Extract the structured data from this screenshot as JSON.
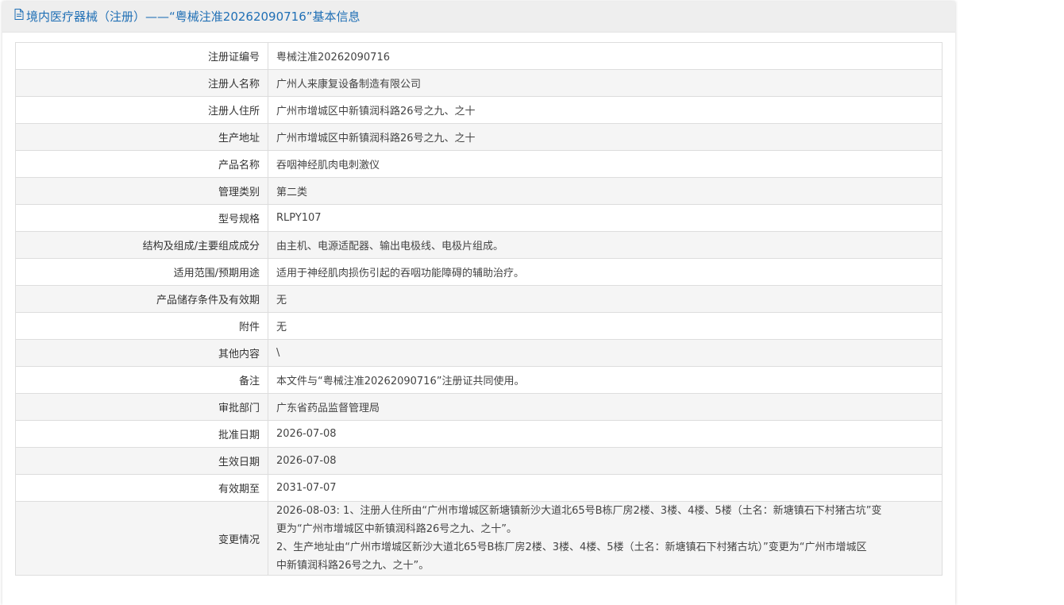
{
  "header": {
    "title": "境内医疗器械（注册）——“粤械注准20262090716”基本信息",
    "icon": "document-icon",
    "color": "#1f6fb5"
  },
  "rows": [
    {
      "label": "注册证编号",
      "value": "粤械注准20262090716"
    },
    {
      "label": "注册人名称",
      "value": "广州人来康复设备制造有限公司"
    },
    {
      "label": "注册人住所",
      "value": "广州市增城区中新镇润科路26号之九、之十"
    },
    {
      "label": "生产地址",
      "value": "广州市增城区中新镇润科路26号之九、之十"
    },
    {
      "label": "产品名称",
      "value": "吞咽神经肌肉电刺激仪"
    },
    {
      "label": "管理类别",
      "value": "第二类"
    },
    {
      "label": "型号规格",
      "value": "RLPY107"
    },
    {
      "label": "结构及组成/主要组成成分",
      "value": "由主机、电源适配器、输出电极线、电极片组成。"
    },
    {
      "label": "适用范围/预期用途",
      "value": "适用于神经肌肉损伤引起的吞咽功能障碍的辅助治疗。"
    },
    {
      "label": "产品储存条件及有效期",
      "value": "无"
    },
    {
      "label": "附件",
      "value": "无"
    },
    {
      "label": "其他内容",
      "value": "\\"
    },
    {
      "label": "备注",
      "value": "本文件与“粤械注准20262090716”注册证共同使用。"
    },
    {
      "label": "审批部门",
      "value": "广东省药品监督管理局"
    },
    {
      "label": "批准日期",
      "value": "2026-07-08"
    },
    {
      "label": "生效日期",
      "value": "2026-07-08"
    },
    {
      "label": "有效期至",
      "value": "2031-07-07"
    }
  ],
  "change": {
    "label": "变更情况",
    "lines": [
      "2026-08-03: 1、注册人住所由“广州市增城区新塘镇新沙大道北65号B栋厂房2楼、3楼、4楼、5楼（土名：新塘镇石下村猪古坑”变",
      "更为“广州市增城区中新镇润科路26号之九、之十”。",
      "2、生产地址由“广州市增城区新沙大道北65号B栋厂房2楼、3楼、4楼、5楼（土名：新塘镇石下村猪古坑）”变更为“广州市增城区",
      "中新镇润科路26号之九、之十”。"
    ]
  }
}
